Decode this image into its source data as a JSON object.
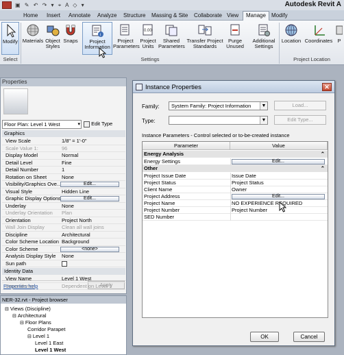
{
  "window": {
    "title": "Autodesk Revit A"
  },
  "tabs": [
    "Home",
    "Insert",
    "Annotate",
    "Analyze",
    "Structure",
    "Massing & Site",
    "Collaborate",
    "View",
    "Manage",
    "Modify"
  ],
  "active_tab": "Manage",
  "ribbon": {
    "select": {
      "modify": "Modify",
      "panel": "Select"
    },
    "settings": {
      "materials": "Materials",
      "object_styles": "Object Styles",
      "snaps": "Snaps",
      "project_information": "Project Information",
      "project_parameters": "Project Parameters",
      "project_units": "Project Units",
      "shared_parameters": "Shared Parameters",
      "transfer_standards": "Transfer Project Standards",
      "purge_unused": "Purge Unused",
      "additional_settings": "Additional Settings",
      "panel": "Settings"
    },
    "project_location": {
      "location": "Location",
      "coordinates": "Coordinates",
      "position": "P",
      "panel": "Project Location"
    }
  },
  "properties": {
    "title": "Properties",
    "type_selector": "Floor Plan: Level 1 West",
    "edit_type": "Edit Type",
    "section_graphics": "Graphics",
    "rows": [
      {
        "k": "View Scale",
        "v": "1/8\" = 1'-0\"",
        "dim": false
      },
      {
        "k": "Scale Value    1:",
        "v": "96",
        "dim": true
      },
      {
        "k": "Display Model",
        "v": "Normal",
        "dim": false
      },
      {
        "k": "Detail Level",
        "v": "Fine",
        "dim": false
      },
      {
        "k": "Detail Number",
        "v": "1",
        "dim": false
      },
      {
        "k": "Rotation on Sheet",
        "v": "None",
        "dim": false
      },
      {
        "k": "Visibility/Graphics Ove...",
        "v": "Edit...",
        "dim": false,
        "button": true
      },
      {
        "k": "Visual Style",
        "v": "Hidden Line",
        "dim": false
      },
      {
        "k": "Graphic Display Options",
        "v": "Edit...",
        "dim": false,
        "button": true
      },
      {
        "k": "Underlay",
        "v": "None",
        "dim": false
      },
      {
        "k": "Underlay Orientation",
        "v": "Plan",
        "dim": true
      },
      {
        "k": "Orientation",
        "v": "Project North",
        "dim": false
      },
      {
        "k": "Wall Join Display",
        "v": "Clean all wall joins",
        "dim": true
      },
      {
        "k": "Discipline",
        "v": "Architectural",
        "dim": false
      },
      {
        "k": "Color Scheme Location",
        "v": "Background",
        "dim": false
      },
      {
        "k": "Color Scheme",
        "v": "<none>",
        "dim": false,
        "button": true
      },
      {
        "k": "Analysis Display Style",
        "v": "None",
        "dim": false
      },
      {
        "k": "Sun path",
        "v": "",
        "dim": false,
        "checkbox": true
      }
    ],
    "section_identity": "Identity Data",
    "identity_rows": [
      {
        "k": "View Name",
        "v": "Level 1 West",
        "dim": false
      },
      {
        "k": "Dependency",
        "v": "Dependent on Level 1",
        "dim": true
      }
    ],
    "help": "Properties help",
    "apply": "Apply"
  },
  "browser": {
    "title": "NER-32.rvt - Project browser",
    "items": [
      {
        "label": "Views (Discipline)",
        "depth": 0
      },
      {
        "label": "Architectural",
        "depth": 1
      },
      {
        "label": "Floor Plans",
        "depth": 2
      },
      {
        "label": "Corridor Parapet",
        "depth": 3
      },
      {
        "label": "Level 1",
        "depth": 3
      },
      {
        "label": "Level 1 East",
        "depth": 4
      },
      {
        "label": "Level 1 West",
        "depth": 4,
        "bold": true
      }
    ]
  },
  "dialog": {
    "title": "Instance Properties",
    "family_label": "Family:",
    "family_value": "System Family: Project Information",
    "load": "Load...",
    "type_label": "Type:",
    "type_value": "",
    "edit_type": "Edit Type...",
    "instance_text": "Instance Parameters - Control selected or to-be-created instance",
    "col_parameter": "Parameter",
    "col_value": "Value",
    "sections": [
      {
        "name": "Energy Analysis",
        "rows": [
          {
            "k": "Energy Settings",
            "v": "Edit...",
            "button": true
          }
        ]
      },
      {
        "name": "Other",
        "rows": [
          {
            "k": "Project Issue Date",
            "v": "Issue Date"
          },
          {
            "k": "Project Status",
            "v": "Project Status"
          },
          {
            "k": "Client Name",
            "v": "Owner"
          },
          {
            "k": "Project Address",
            "v": "Edit...",
            "button": true
          },
          {
            "k": "Project Name",
            "v": "NO EXPERIENCE REQUIRED"
          },
          {
            "k": "Project Number",
            "v": "Project Number"
          },
          {
            "k": "SED Number",
            "v": ""
          }
        ]
      }
    ],
    "ok": "OK",
    "cancel": "Cancel"
  },
  "colors": {
    "accent": "#3E6DB5",
    "ribbon_bg": "#E8ECF1",
    "dialog_bg": "#F0F0F0"
  }
}
